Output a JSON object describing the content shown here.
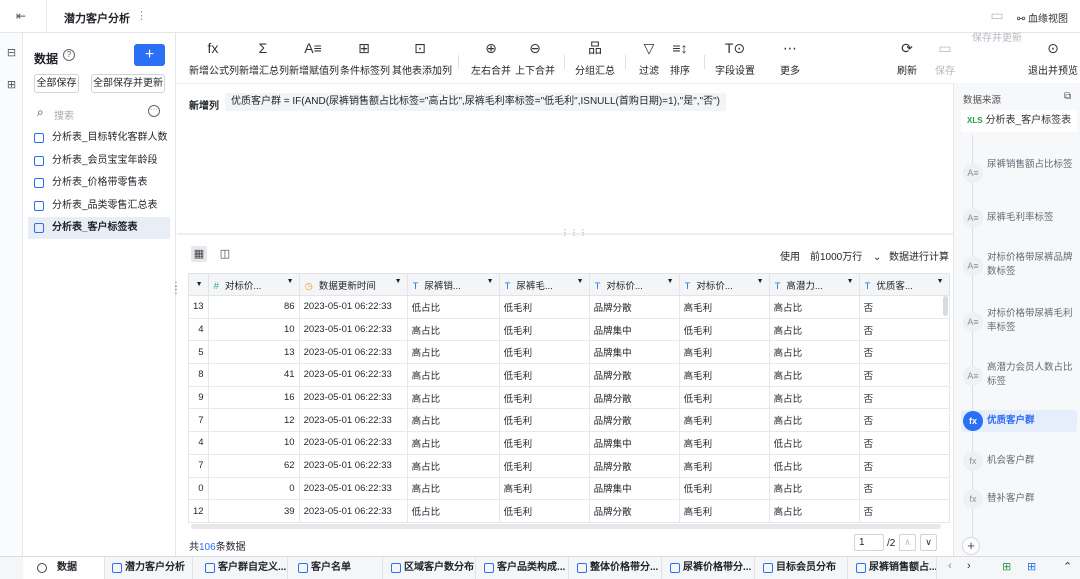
{
  "topbar": {
    "back_icon": "exit-icon",
    "title": "潜力客户分析",
    "more": "⋮",
    "lineage": "血缘视图"
  },
  "side": {
    "title": "数据",
    "add": "+",
    "save_all": "全部保存",
    "save_update": "全部保存并更新",
    "search_placeholder": "搜索",
    "items": [
      "分析表_目标转化客群人数",
      "分析表_会员宝宝年龄段",
      "分析表_价格带零售表",
      "分析表_品类零售汇总表",
      "分析表_客户标签表"
    ]
  },
  "toolbar": {
    "tools": [
      {
        "icon": "fx",
        "label": "新增公式列"
      },
      {
        "icon": "Σ",
        "label": "新增汇总列"
      },
      {
        "icon": "A≡",
        "label": "新增赋值列"
      },
      {
        "icon": "⊞",
        "label": "条件标签列"
      },
      {
        "icon": "⊡",
        "label": "其他表添加列"
      },
      {
        "icon": "⊕",
        "label": "左右合并"
      },
      {
        "icon": "⊖",
        "label": "上下合并"
      },
      {
        "icon": "品",
        "label": "分组汇总"
      },
      {
        "icon": "▽",
        "label": "过滤"
      },
      {
        "icon": "≡↕",
        "label": "排序"
      },
      {
        "icon": "T⊙",
        "label": "字段设置"
      },
      {
        "icon": "⋯",
        "label": "更多"
      }
    ],
    "right": [
      {
        "icon": "⟳",
        "label": "刷新"
      },
      {
        "icon": "▭",
        "label": "保存"
      },
      {
        "icon": "▭",
        "label": "保存并更新"
      },
      {
        "icon": "⊙",
        "label": "退出并预览"
      }
    ]
  },
  "formula": {
    "label": "新增列",
    "expression": "优质客户群 = IF(AND(尿裤销售额占比标签=\"高占比\",尿裤毛利率标签=\"低毛利\",ISNULL(首购日期)=1),\"是\",\"否\")"
  },
  "grid": {
    "use_label": "使用",
    "rows_option": "前1000万行",
    "calc": "数据进行计算",
    "columns": [
      "对标价...",
      "数据更新时间",
      "尿裤销...",
      "尿裤毛...",
      "对标价...",
      "对标价...",
      "高潜力...",
      "优质客..."
    ],
    "rows": [
      [
        "13",
        "86",
        "2023-05-01 06:22:33",
        "低占比",
        "低毛利",
        "品牌分散",
        "高毛利",
        "高占比",
        "否"
      ],
      [
        "4",
        "10",
        "2023-05-01 06:22:33",
        "高占比",
        "低毛利",
        "品牌集中",
        "低毛利",
        "高占比",
        "否"
      ],
      [
        "5",
        "13",
        "2023-05-01 06:22:33",
        "高占比",
        "低毛利",
        "品牌集中",
        "高毛利",
        "高占比",
        "否"
      ],
      [
        "8",
        "41",
        "2023-05-01 06:22:33",
        "高占比",
        "低毛利",
        "品牌分散",
        "高毛利",
        "高占比",
        "否"
      ],
      [
        "9",
        "16",
        "2023-05-01 06:22:33",
        "高占比",
        "低毛利",
        "品牌分散",
        "低毛利",
        "高占比",
        "否"
      ],
      [
        "7",
        "12",
        "2023-05-01 06:22:33",
        "高占比",
        "低毛利",
        "品牌分散",
        "高毛利",
        "高占比",
        "否"
      ],
      [
        "4",
        "10",
        "2023-05-01 06:22:33",
        "高占比",
        "低毛利",
        "品牌集中",
        "高毛利",
        "低占比",
        "否"
      ],
      [
        "7",
        "62",
        "2023-05-01 06:22:33",
        "高占比",
        "低毛利",
        "品牌分散",
        "高毛利",
        "低占比",
        "否"
      ],
      [
        "0",
        "0",
        "2023-05-01 06:22:33",
        "高占比",
        "高毛利",
        "品牌集中",
        "低毛利",
        "高占比",
        "否"
      ],
      [
        "12",
        "39",
        "2023-05-01 06:22:33",
        "低占比",
        "低毛利",
        "品牌分散",
        "高毛利",
        "高占比",
        "否"
      ]
    ],
    "footer_prefix": "共",
    "total": "106",
    "footer_suffix": "条数据",
    "page": "1",
    "pages": "/2"
  },
  "rpanel": {
    "title": "数据来源",
    "source": "分析表_客户标签表",
    "steps": [
      {
        "icon": "A≡",
        "label": "尿裤销售额占比标签"
      },
      {
        "icon": "A≡",
        "label": "尿裤毛利率标签"
      },
      {
        "icon": "A≡",
        "label": "对标价格带尿裤品牌数标签"
      },
      {
        "icon": "A≡",
        "label": "对标价格带尿裤毛利率标签"
      },
      {
        "icon": "A≡",
        "label": "高潜力会员人数占比标签"
      },
      {
        "icon": "fx",
        "label": "优质客户群"
      },
      {
        "icon": "fx",
        "label": "机会客户群"
      },
      {
        "icon": "fx",
        "label": "替补客户群"
      }
    ]
  },
  "tabs": [
    "数据",
    "潜力客户分析",
    "客户群自定义...",
    "客户名单",
    "区域客户数分布",
    "客户品类构成...",
    "整体价格带分...",
    "尿裤价格带分...",
    "目标会员分布",
    "尿裤销售额占..."
  ],
  "colors": {
    "accent": "#2b6ff5"
  }
}
